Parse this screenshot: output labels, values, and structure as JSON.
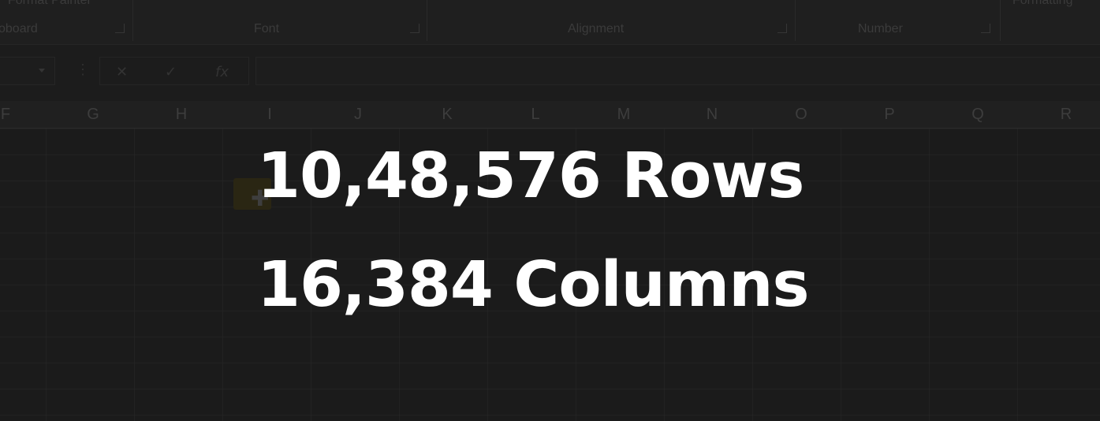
{
  "ribbon": {
    "top_texts": [
      "Format Painter",
      "Formatting"
    ],
    "groups": [
      "oboard",
      "Font",
      "Alignment",
      "Number"
    ]
  },
  "formula_bar": {
    "fx_symbol": "fx",
    "cancel_symbol": "✕",
    "enter_symbol": "✓"
  },
  "column_headers": [
    "F",
    "G",
    "H",
    "I",
    "J",
    "K",
    "L",
    "M",
    "N",
    "O",
    "P",
    "Q",
    "R"
  ],
  "overlay": {
    "line1": "10,48,576 Rows",
    "line2": "16,384 Columns"
  },
  "icons": {
    "cursor": "cell-select-cross-icon"
  }
}
